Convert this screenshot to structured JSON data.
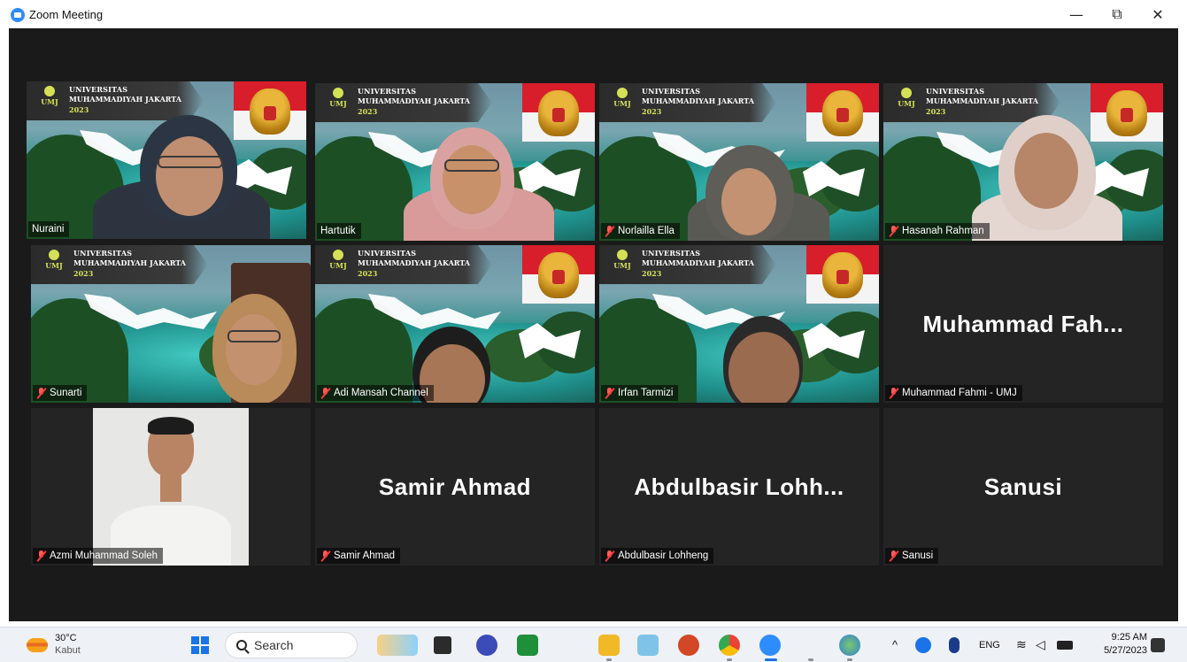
{
  "window": {
    "title": "Zoom Meeting",
    "minimize_glyph": "—",
    "restore_glyph": "⧉",
    "close_glyph": "✕"
  },
  "banner": {
    "line1": "UNIVERSITAS",
    "line2": "MUHAMMADIYAH JAKARTA",
    "line3": "2023",
    "logo_text": "UMJ"
  },
  "participants": [
    {
      "name": "Nuraini",
      "muted": false,
      "active_speaker": true,
      "view": "video"
    },
    {
      "name": "Hartutik",
      "muted": false,
      "active_speaker": false,
      "view": "video"
    },
    {
      "name": "Norlailla Ella",
      "muted": true,
      "active_speaker": false,
      "view": "video"
    },
    {
      "name": "Hasanah Rahman",
      "muted": true,
      "active_speaker": false,
      "view": "video"
    },
    {
      "name": "Sunarti",
      "muted": true,
      "active_speaker": false,
      "view": "video"
    },
    {
      "name": "Adi Mansah Channel",
      "muted": true,
      "active_speaker": false,
      "view": "video"
    },
    {
      "name": "Irfan Tarmizi",
      "muted": true,
      "active_speaker": false,
      "view": "video"
    },
    {
      "name": "Muhammad Fahmi - UMJ",
      "display_name": "Muhammad  Fah...",
      "muted": true,
      "active_speaker": false,
      "view": "name"
    },
    {
      "name": "Azmi Muhammad Soleh",
      "muted": true,
      "active_speaker": false,
      "view": "photo"
    },
    {
      "name": "Samir Ahmad",
      "display_name": "Samir Ahmad",
      "muted": true,
      "active_speaker": false,
      "view": "name"
    },
    {
      "name": "Abdulbasir Lohheng",
      "display_name": "Abdulbasir  Lohh...",
      "muted": true,
      "active_speaker": false,
      "view": "name"
    },
    {
      "name": "Sanusi",
      "display_name": "Sanusi",
      "muted": true,
      "active_speaker": false,
      "view": "name"
    }
  ],
  "taskbar": {
    "weather_temp": "30°C",
    "weather_condition": "Kabut",
    "search_label": "Search",
    "apps": [
      "widgets-icon",
      "task-view-icon",
      "meet-icon",
      "xbox-icon",
      "slash-app-icon",
      "file-explorer-icon",
      "photos-icon",
      "powerpoint-icon",
      "chrome-icon",
      "zoom-icon",
      "wps-icon",
      "paint-icon"
    ],
    "tray_chevron": "^",
    "language": "ENG",
    "time": "9:25 AM",
    "date": "5/27/2023"
  },
  "colors": {
    "meeting_bg": "#1a1a1a",
    "tile_bg": "#242424",
    "active_speaker": "#d4e157",
    "muted_mic": "#ff3b3b",
    "zoom_blue": "#2d8cff"
  }
}
